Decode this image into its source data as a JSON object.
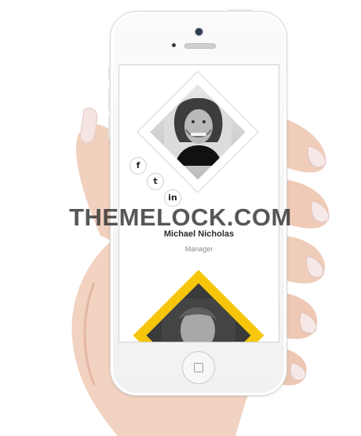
{
  "profile_1": {
    "name": "Michael Nicholas",
    "role": "Manager",
    "social": [
      {
        "icon": "facebook-icon",
        "glyph": "f"
      },
      {
        "icon": "twitter-icon",
        "glyph": "t"
      },
      {
        "icon": "linkedin-icon",
        "glyph": "in"
      }
    ]
  },
  "profile_2": {
    "accent": "#f5c60a"
  },
  "watermark": "THEMELOCK.COM",
  "colors": {
    "skin": "#f0cdbb",
    "skin_shadow": "#e2b29c",
    "nail": "#f6e8e6",
    "phone_body": "#f4f4f4",
    "accent": "#f5c60a"
  }
}
